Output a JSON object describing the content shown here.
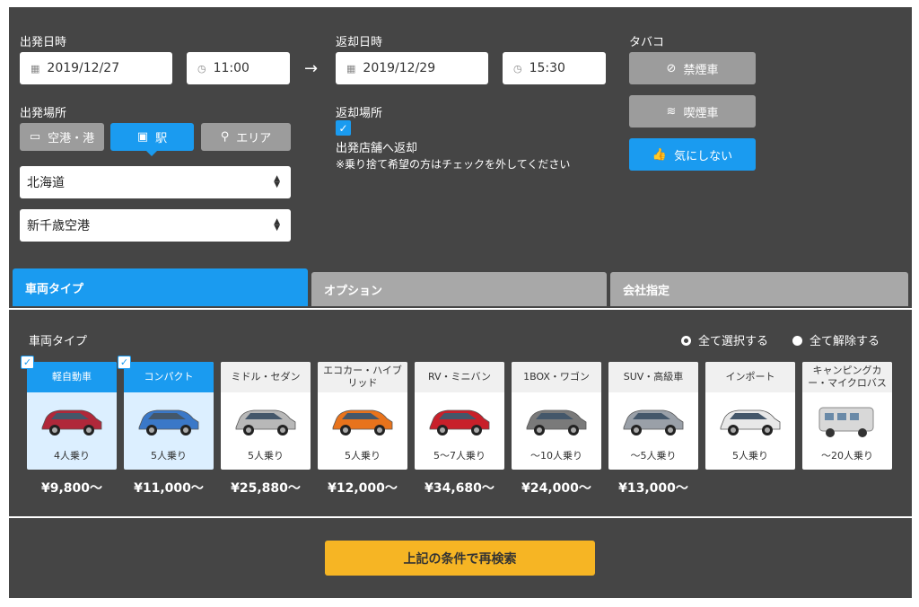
{
  "departure": {
    "label": "出発日時",
    "date": "2019/12/27",
    "time": "11:00"
  },
  "return": {
    "label": "返却日時",
    "date": "2019/12/29",
    "time": "15:30"
  },
  "tobacco": {
    "label": "タバコ",
    "options": [
      {
        "label": "禁煙車",
        "icon": "no-smoking-icon",
        "selected": false
      },
      {
        "label": "喫煙車",
        "icon": "smoking-icon",
        "selected": false
      },
      {
        "label": "気にしない",
        "icon": "thumbs-up-icon",
        "selected": true
      }
    ]
  },
  "pickup": {
    "label": "出発場所",
    "tabs": [
      {
        "label": "空港・港",
        "icon": "ticket-icon",
        "selected": false
      },
      {
        "label": "駅",
        "icon": "train-icon",
        "selected": true
      },
      {
        "label": "エリア",
        "icon": "map-pin-icon",
        "selected": false
      }
    ],
    "prefecture": "北海道",
    "location": "新千歳空港"
  },
  "return_place": {
    "label": "返却場所",
    "checkbox_label": "出発店舗へ返却",
    "note": "※乗り捨て希望の方はチェックを外してください",
    "checked": true
  },
  "tabs": [
    {
      "label": "車両タイプ",
      "active": true
    },
    {
      "label": "オプション",
      "active": false
    },
    {
      "label": "会社指定",
      "active": false
    }
  ],
  "vehicle": {
    "section_label": "車両タイプ",
    "select_all": "全て選択する",
    "deselect_all": "全て解除する",
    "cards": [
      {
        "name": "軽自動車",
        "capacity": "4人乗り",
        "price": "¥9,800〜",
        "selected": true,
        "color": "#b0283a"
      },
      {
        "name": "コンパクト",
        "capacity": "5人乗り",
        "price": "¥11,000〜",
        "selected": true,
        "color": "#3a78c8"
      },
      {
        "name": "ミドル・セダン",
        "capacity": "5人乗り",
        "price": "¥25,880〜",
        "selected": false,
        "color": "#b8b8b8"
      },
      {
        "name": "エコカー・ハイブリッド",
        "capacity": "5人乗り",
        "price": "¥12,000〜",
        "selected": false,
        "color": "#e8731c"
      },
      {
        "name": "RV・ミニバン",
        "capacity": "5〜7人乗り",
        "price": "¥34,680〜",
        "selected": false,
        "color": "#c8202a"
      },
      {
        "name": "1BOX・ワゴン",
        "capacity": "〜10人乗り",
        "price": "¥24,000〜",
        "selected": false,
        "color": "#7a7a7a"
      },
      {
        "name": "SUV・高級車",
        "capacity": "〜5人乗り",
        "price": "¥13,000〜",
        "selected": false,
        "color": "#9aa0a8"
      },
      {
        "name": "インポート",
        "capacity": "5人乗り",
        "price": "",
        "selected": false,
        "color": "#e8e8e8"
      },
      {
        "name": "キャンピングカー・マイクロバス",
        "capacity": "〜20人乗り",
        "price": "",
        "selected": false,
        "color": "#d8d8d8"
      }
    ]
  },
  "search_button": "上記の条件で再検索",
  "colors": {
    "panel": "#454545",
    "accent": "#1a9bf0",
    "search": "#f6b524"
  }
}
